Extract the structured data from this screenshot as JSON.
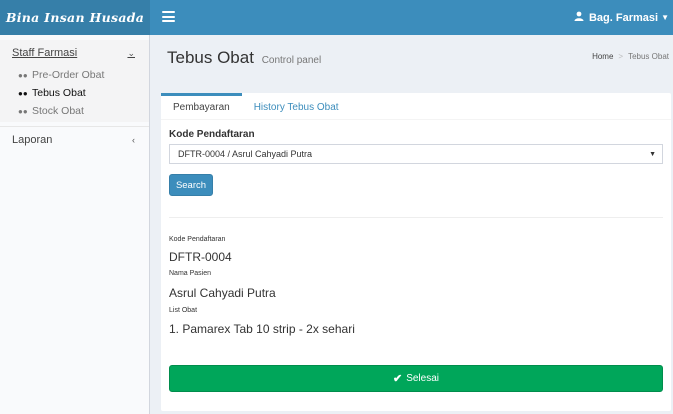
{
  "app": {
    "logo": "Bina Insan Husada"
  },
  "header": {
    "user_name": "Bag. Farmasi",
    "user_icon": "user-icon",
    "menu_icon": "hamburger-icon"
  },
  "sidebar": {
    "group1": {
      "label": "Staff Farmasi",
      "items": [
        {
          "label": "Pre-Order Obat"
        },
        {
          "label": "Tebus Obat"
        },
        {
          "label": "Stock Obat"
        }
      ]
    },
    "group2": {
      "label": "Laporan"
    }
  },
  "page": {
    "title": "Tebus Obat",
    "subtitle": "Control panel",
    "breadcrumb": {
      "home": "Home",
      "current": "Tebus Obat"
    }
  },
  "tabs": [
    {
      "label": "Pembayaran"
    },
    {
      "label": "History Tebus Obat"
    }
  ],
  "form": {
    "field_label": "Kode Pendaftaran",
    "selected_value": "DFTR-0004 / Asrul Cahyadi Putra",
    "search_label": "Search"
  },
  "result": {
    "kode_label": "Kode Pendaftaran",
    "kode_value": "DFTR-0004",
    "nama_label": "Nama Pasien",
    "nama_value": "Asrul Cahyadi Putra",
    "obat_label": "List Obat",
    "obat_items": [
      "1. Pamarex Tab 10 strip - 2x sehari"
    ]
  },
  "actions": {
    "done_label": "Selesai"
  },
  "colors": {
    "primary": "#3c8dbc",
    "primary_dark": "#367fa9",
    "success": "#00a65a"
  }
}
